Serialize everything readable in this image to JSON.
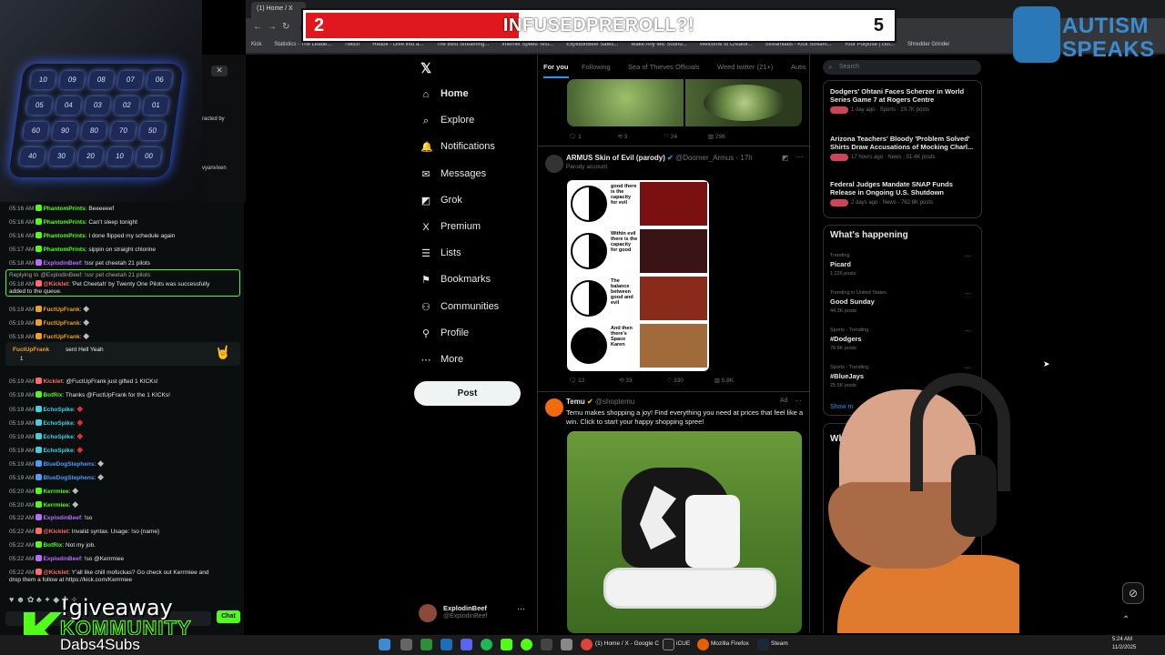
{
  "browser": {
    "tab_title": "(1) Home / X",
    "bookmarks": [
      "Kick",
      "Statistics - The Leade...",
      "Twitch",
      "Reddit - Dive into a...",
      "The Best Streaming...",
      "Internet Speed Test...",
      "ExplodinBeef Sales...",
      "Make Any Mic Sound...",
      "Welcome to Creator...",
      "Streamlabs - Kick Stream...",
      "Your Purpose | clot...",
      "Shredder Grinder"
    ]
  },
  "banner": {
    "left_num": "2",
    "title": "INFUSEDPREROLL?!",
    "right_num": "5"
  },
  "logo": {
    "line1": "AUTISM",
    "line2": "SPEAKS"
  },
  "keypad_keys": [
    "10",
    "09",
    "08",
    "07",
    "06",
    "05",
    "04",
    "03",
    "02",
    "01",
    "60",
    "90",
    "80",
    "70",
    "50",
    "40",
    "30",
    "20",
    "10",
    "00"
  ],
  "side_popup": {
    "fragments": [
      "racted by",
      "vyanvixen"
    ]
  },
  "chat": {
    "messages": [
      {
        "ts": "05:16 AM",
        "user": "PhantomPrints",
        "color": "#53fc18",
        "text": "Beeeeeef"
      },
      {
        "ts": "05:16 AM",
        "user": "PhantomPrints",
        "color": "#53fc18",
        "text": "Can't sleep tonight"
      },
      {
        "ts": "05:16 AM",
        "user": "PhantomPrints",
        "color": "#53fc18",
        "text": "I done flipped my schedule again"
      },
      {
        "ts": "05:17 AM",
        "user": "PhantomPrints",
        "color": "#53fc18",
        "text": "sippin on straight chlorine"
      },
      {
        "ts": "05:18 AM",
        "user": "ExplodinBeef",
        "color": "#b86cff",
        "text": "!ssr pet cheetah 21 pilots"
      },
      {
        "ts": "05:18 AM",
        "user": "@Kicklet",
        "color": "#ff6b6b",
        "text": "'Pet Cheetah' by Twenty One Pilots was successfully"
      },
      {
        "ts": "",
        "user": "",
        "color": "#e6e6e6",
        "text": "added to the queue."
      },
      {
        "ts": "05:19 AM",
        "user": "FuctUpFrank",
        "color": "#f0a020",
        "text": ""
      },
      {
        "ts": "05:19 AM",
        "user": "FuctUpFrank",
        "color": "#f0a020",
        "text": ""
      },
      {
        "ts": "05:19 AM",
        "user": "FuctUpFrank",
        "color": "#f0a020",
        "text": ""
      },
      {
        "ts": "05:19 AM",
        "user": "Kicklet",
        "color": "#ff6b6b",
        "text": "@FuctUpFrank just gifted 1 KICKs!"
      },
      {
        "ts": "05:19 AM",
        "user": "BotRix",
        "color": "#53fc18",
        "text": "Thanks @FuctUpFrank for the 1 KICKs!"
      },
      {
        "ts": "05:19 AM",
        "user": "EchoSpike",
        "color": "#3fd0e0",
        "text": ""
      },
      {
        "ts": "05:19 AM",
        "user": "EchoSpike",
        "color": "#3fd0e0",
        "text": ""
      },
      {
        "ts": "05:19 AM",
        "user": "EchoSpike",
        "color": "#3fd0e0",
        "text": ""
      },
      {
        "ts": "05:19 AM",
        "user": "EchoSpike",
        "color": "#3fd0e0",
        "text": ""
      },
      {
        "ts": "05:19 AM",
        "user": "BlueDogStephens",
        "color": "#4a9dff",
        "text": ""
      },
      {
        "ts": "05:19 AM",
        "user": "BlueDogStephens",
        "color": "#4a9dff",
        "text": ""
      },
      {
        "ts": "05:20 AM",
        "user": "Kerrmiee",
        "color": "#53fc18",
        "text": ""
      },
      {
        "ts": "05:20 AM",
        "user": "Kerrmiee",
        "color": "#53fc18",
        "text": ""
      },
      {
        "ts": "05:22 AM",
        "user": "ExplodinBeef",
        "color": "#b86cff",
        "text": "!so"
      },
      {
        "ts": "05:22 AM",
        "user": "@Kicklet",
        "color": "#ff6b6b",
        "text": "Invalid syntax. Usage: !so {name}"
      },
      {
        "ts": "05:22 AM",
        "user": "BotRix",
        "color": "#53fc18",
        "text": "Not my job."
      },
      {
        "ts": "05:22 AM",
        "user": "ExplodinBeef",
        "color": "#b86cff",
        "text": "!so @Kerrmiee"
      },
      {
        "ts": "05:22 AM",
        "user": "@Kicklet",
        "color": "#ff6b6b",
        "text": "Y'all like chill mofuckas? Go check out Kerrmiee and"
      },
      {
        "ts": "",
        "user": "",
        "color": "#e6e6e6",
        "text": "drop them a follow at https://kick.com/Kerrmiee"
      }
    ],
    "reply_line": "Replying to @ExplodinBeef: !ssr pet cheetah 21 pilots",
    "gift": {
      "user": "FuctUpFrank",
      "text": "sent Hell Yeah",
      "count": "1"
    },
    "send_label": "Chat",
    "overlay_line1": "!giveaway",
    "overlay_line2": "KOMMUNITY",
    "overlay_line3": "Dabs4Subs"
  },
  "xnav": {
    "items": [
      {
        "label": "Home",
        "icon": "⌂"
      },
      {
        "label": "Explore",
        "icon": "⌕"
      },
      {
        "label": "Notifications",
        "icon": "🔔"
      },
      {
        "label": "Messages",
        "icon": "✉"
      },
      {
        "label": "Grok",
        "icon": "◩"
      },
      {
        "label": "Premium",
        "icon": "X"
      },
      {
        "label": "Lists",
        "icon": "☰"
      },
      {
        "label": "Bookmarks",
        "icon": "⚑"
      },
      {
        "label": "Communities",
        "icon": "⚇"
      },
      {
        "label": "Profile",
        "icon": "⚲"
      },
      {
        "label": "More",
        "icon": "⋯"
      }
    ],
    "post_label": "Post",
    "account_name": "ExplodinBeef",
    "account_handle": "@ExplodinBeef"
  },
  "feed": {
    "tabs": [
      "For you",
      "Following",
      "Sea of Thieves Officials",
      "Weed twitter (21+)",
      "Autis"
    ],
    "tweet1_actions": {
      "replies": "1",
      "reposts": "3",
      "likes": "24",
      "views": "296"
    },
    "tweet2": {
      "name": "ARMUS Skin of Evil (parody)",
      "handle": "@Doomer_Armus",
      "time": "17h",
      "label": "Parody account",
      "panels": [
        "good there is the capacity for evil",
        "Within evil there is the capacity for good",
        "The balance between good and evil",
        "And then there's Space Karen"
      ],
      "replies": "12",
      "reposts": "33",
      "likes": "330",
      "views": "5.8K"
    },
    "tweet3": {
      "name": "Temu",
      "handle": "@shoptemu",
      "ad": "Ad",
      "text": "Temu makes shopping a joy! Find everything you need at prices that feel like a win. Click to start your happy shopping spree!"
    }
  },
  "right": {
    "search_placeholder": "Search",
    "news": [
      {
        "title": "Dodgers' Ohtani Faces Scherzer in World Series Game 7 at Rogers Centre",
        "meta": "1 day ago · Sports · 29.7K posts"
      },
      {
        "title": "Arizona Teachers' Bloody 'Problem Solved' Shirts Draw Accusations of Mocking Charl...",
        "meta": "17 hours ago · News · 51.4K posts"
      },
      {
        "title": "Federal Judges Mandate SNAP Funds Release in Ongoing U.S. Shutdown",
        "meta": "2 days ago · News · 762.8K posts"
      }
    ],
    "happening_title": "What's happening",
    "trends": [
      {
        "cat": "Trending",
        "name": "Picard",
        "posts": "1,226 posts"
      },
      {
        "cat": "Trending in United States",
        "name": "Good Sunday",
        "posts": "44.3K posts"
      },
      {
        "cat": "Sports · Trending",
        "name": "#Dodgers",
        "posts": "78.8K posts"
      },
      {
        "cat": "Sports · Trending",
        "name": "#BlueJays",
        "posts": "25.5K posts"
      }
    ],
    "show_more": "Show m",
    "who_to_follow_fragment": "Wh"
  },
  "taskbar": {
    "items": [
      "(1) Home / X - Google C",
      "iCUE",
      "Mozilla Firefox",
      "Steam"
    ],
    "time": "5:24 AM",
    "date": "11/2/2025"
  }
}
